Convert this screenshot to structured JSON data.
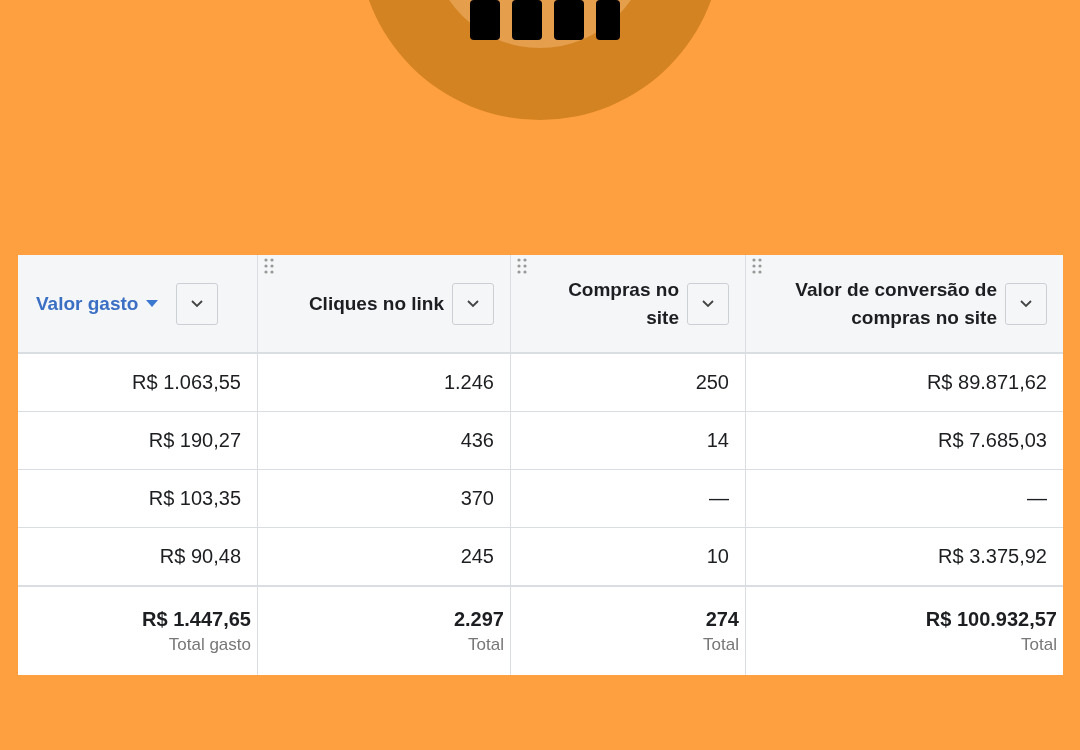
{
  "table": {
    "columns": [
      {
        "label": "Valor gasto",
        "sorted": true
      },
      {
        "label": "Cliques no link",
        "sorted": false
      },
      {
        "label": "Compras no site",
        "sorted": false
      },
      {
        "label": "Valor de conversão de compras no site",
        "sorted": false
      }
    ],
    "rows": [
      [
        "R$ 1.063,55",
        "1.246",
        "250",
        "R$ 89.871,62"
      ],
      [
        "R$ 190,27",
        "436",
        "14",
        "R$ 7.685,03"
      ],
      [
        "R$ 103,35",
        "370",
        "—",
        "—"
      ],
      [
        "R$ 90,48",
        "245",
        "10",
        "R$ 3.375,92"
      ]
    ],
    "totals": [
      {
        "value": "R$ 1.447,65",
        "label": "Total gasto"
      },
      {
        "value": "2.297",
        "label": "Total"
      },
      {
        "value": "274",
        "label": "Total"
      },
      {
        "value": "R$ 100.932,57",
        "label": "Total"
      }
    ]
  }
}
